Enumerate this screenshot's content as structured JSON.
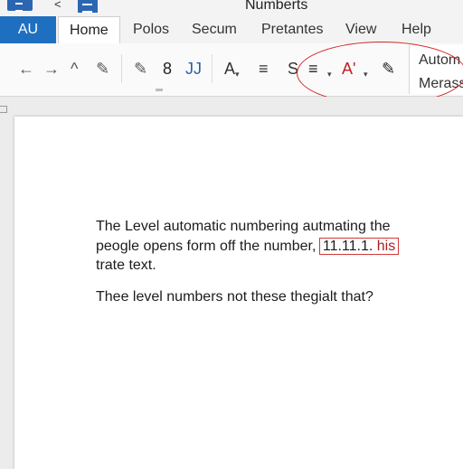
{
  "window": {
    "title": "Numberts"
  },
  "tabs": {
    "file": "AU",
    "items": [
      {
        "label": "Home",
        "active": true
      },
      {
        "label": "Polos"
      },
      {
        "label": "Secum"
      },
      {
        "label": "Pretantes"
      },
      {
        "label": "View"
      },
      {
        "label": "Help"
      }
    ]
  },
  "ribbon": {
    "buttons": {
      "undo": "←",
      "redo": "→",
      "up": "^",
      "format_painter": "✎",
      "pen": "✎",
      "digit": "8",
      "jj": "JJ",
      "font_a": "A",
      "lines": "≡",
      "strike_s": "S",
      "align": "≡",
      "font_color": "A'",
      "dropdown": "▾",
      "eyedropper": "✎"
    },
    "styles": [
      "Autom",
      "Merass"
    ]
  },
  "document": {
    "paragraph1": {
      "line1": "The Level automatic numbering  autmating the",
      "line2_before": "peogle opens form off the number, ",
      "boxed_number": "11.11.1.",
      "boxed_word": "his",
      "line3": "trate text."
    },
    "paragraph2": "Thee level numbers not these thegialt that?"
  },
  "colors": {
    "accent": "#1e6fc0",
    "highlight": "#d42a2a"
  }
}
